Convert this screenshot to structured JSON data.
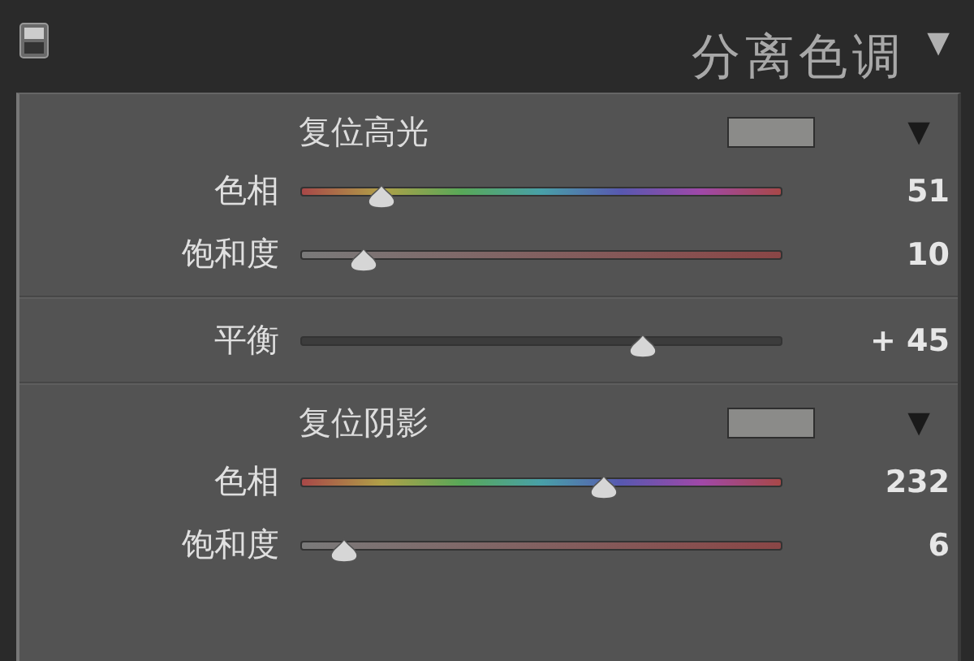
{
  "panel": {
    "title": "分离色调",
    "collapse_icon": "▼"
  },
  "sections": [
    {
      "header": "复位高光",
      "color": "#8b8b89",
      "menu_icon": "▼",
      "sliders": [
        {
          "label": "色相",
          "kind": "hue",
          "level": 0.17,
          "reading": "51"
        },
        {
          "label": "饱和度",
          "kind": "saturation",
          "level": 0.13,
          "reading": "10"
        }
      ]
    },
    {
      "sliders": [
        {
          "label": "平衡",
          "kind": "balance",
          "level": 0.71,
          "reading": "+ 45"
        }
      ]
    },
    {
      "header": "复位阴影",
      "color": "#8b8b89",
      "menu_icon": "▼",
      "sliders": [
        {
          "label": "色相",
          "kind": "hue",
          "level": 0.63,
          "reading": "232"
        },
        {
          "label": "饱和度",
          "kind": "saturation",
          "level": 0.09,
          "reading": "6"
        }
      ]
    }
  ]
}
